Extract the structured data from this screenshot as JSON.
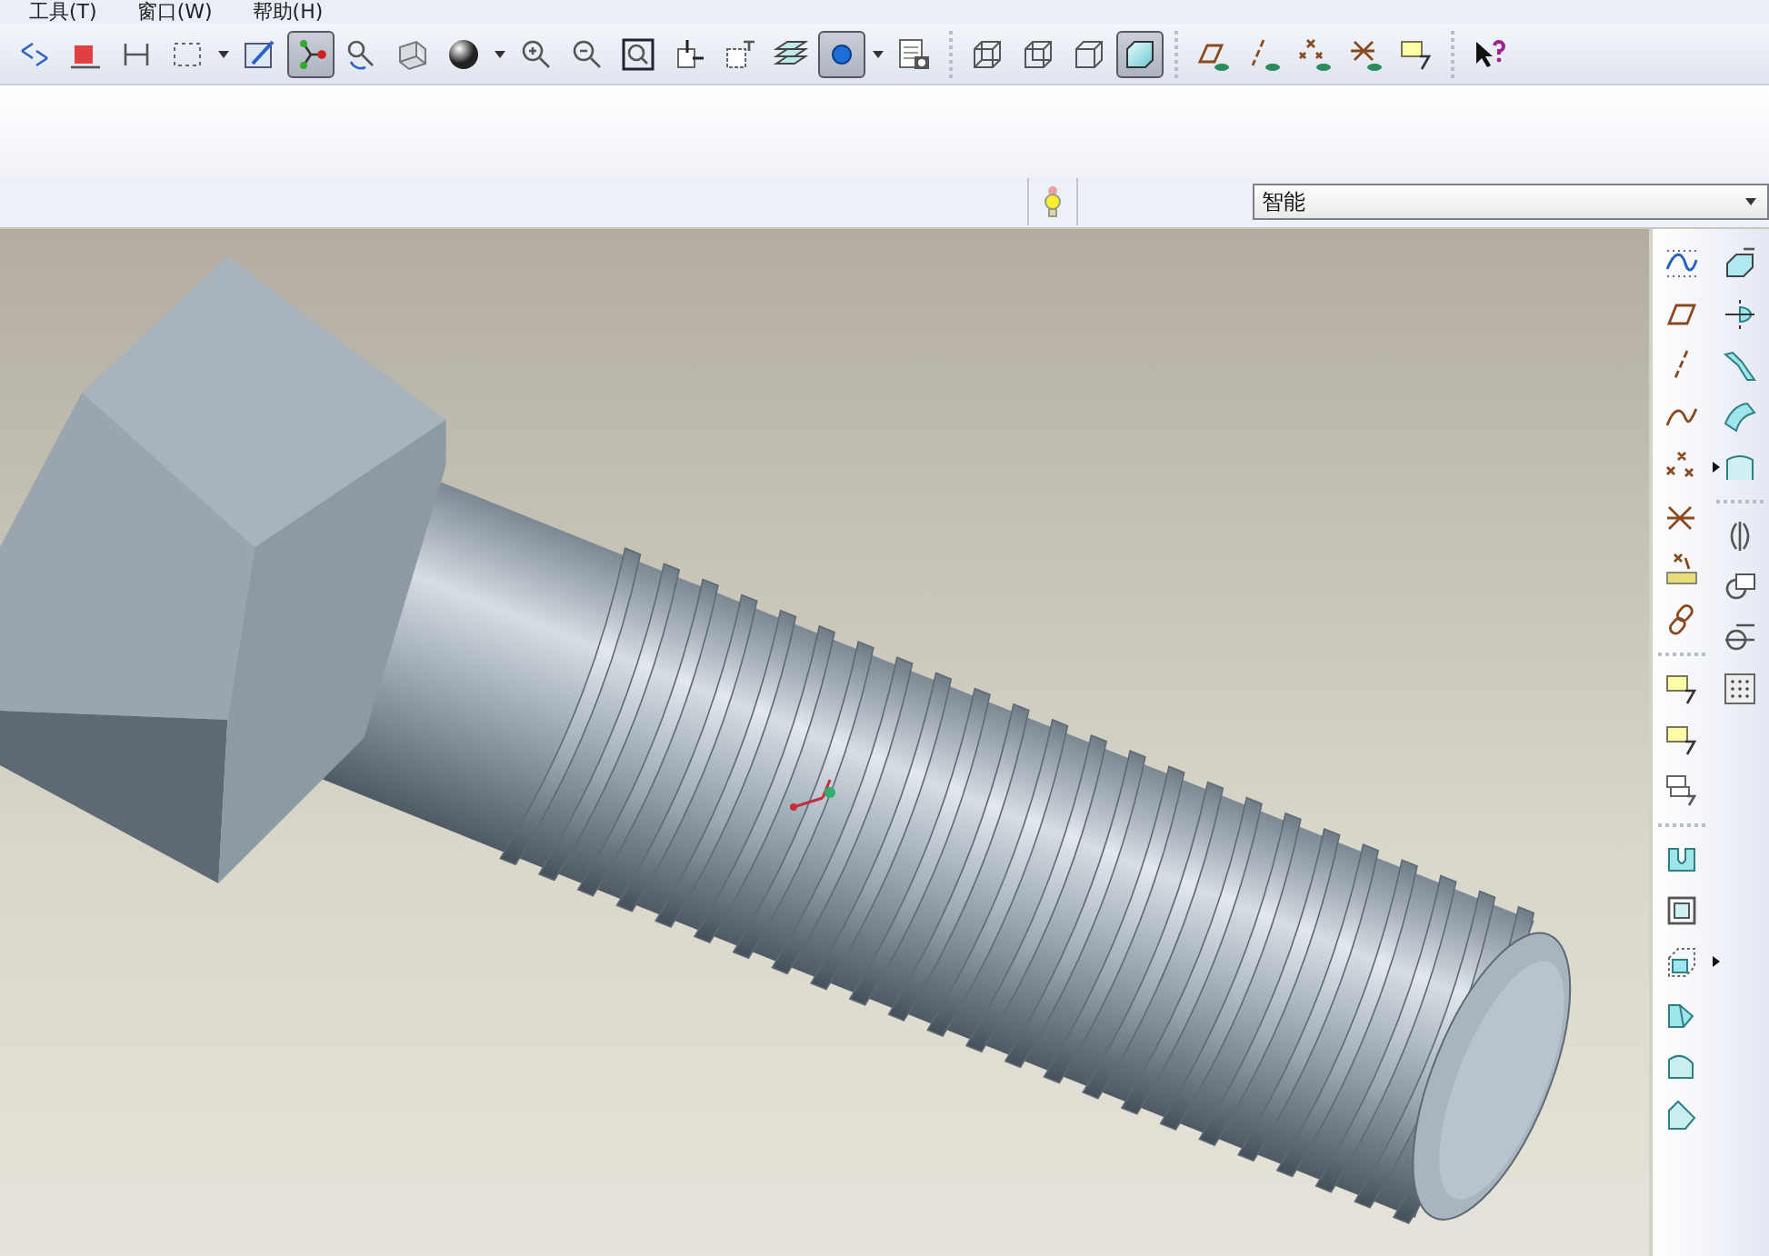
{
  "menu": [
    {
      "label": "工具(T)"
    },
    {
      "label": "窗口(W)"
    },
    {
      "label": "帮助(H)"
    }
  ],
  "toolbar": [
    {
      "kind": "regenerate",
      "selected": false
    },
    {
      "kind": "redbox",
      "selected": false
    },
    {
      "kind": "spin",
      "selected": false
    },
    {
      "kind": "selectbox",
      "selected": false,
      "dropdown": true
    },
    {
      "kind": "sketch",
      "selected": false
    },
    {
      "kind": "datum",
      "selected": true
    },
    {
      "kind": "spincenter",
      "selected": false
    },
    {
      "kind": "orient",
      "selected": false
    },
    {
      "kind": "sphere",
      "selected": false,
      "dropdown": true
    },
    {
      "kind": "zoomin",
      "selected": false
    },
    {
      "kind": "zoomout",
      "selected": false
    },
    {
      "kind": "refit",
      "selected": false
    },
    {
      "kind": "repaint",
      "selected": false
    },
    {
      "kind": "namedview",
      "selected": false
    },
    {
      "kind": "layers",
      "selected": false
    },
    {
      "kind": "bluesphere",
      "selected": true,
      "dropdown": true
    },
    {
      "kind": "viewmanager",
      "selected": false
    },
    {
      "kind": "separator"
    },
    {
      "kind": "wireframe",
      "selected": false
    },
    {
      "kind": "hidden",
      "selected": false
    },
    {
      "kind": "nohidden",
      "selected": false
    },
    {
      "kind": "shaded",
      "selected": true
    },
    {
      "kind": "separator"
    },
    {
      "kind": "planes",
      "selected": false
    },
    {
      "kind": "axes",
      "selected": false
    },
    {
      "kind": "points",
      "selected": false
    },
    {
      "kind": "csys",
      "selected": false
    },
    {
      "kind": "note",
      "selected": false
    },
    {
      "kind": "separator"
    },
    {
      "kind": "help",
      "selected": false
    }
  ],
  "filter": {
    "value": "智能"
  },
  "right_toolbar": {
    "column_1": [
      {
        "kind": "sketchcurve",
        "flyout": false
      },
      {
        "kind": "plane",
        "flyout": false
      },
      {
        "kind": "axis",
        "flyout": false
      },
      {
        "kind": "curve",
        "flyout": false
      },
      {
        "kind": "point",
        "flyout": true
      },
      {
        "kind": "csys",
        "flyout": false
      },
      {
        "kind": "analysis",
        "flyout": false
      },
      {
        "kind": "chain",
        "flyout": false
      },
      {
        "kind": "separator"
      },
      {
        "kind": "note",
        "flyout": false
      },
      {
        "kind": "note",
        "flyout": false
      },
      {
        "kind": "note2",
        "flyout": false
      },
      {
        "kind": "separator"
      },
      {
        "kind": "hole",
        "flyout": false
      },
      {
        "kind": "shell",
        "flyout": false
      },
      {
        "kind": "rib",
        "flyout": true
      },
      {
        "kind": "draft",
        "flyout": false
      },
      {
        "kind": "round",
        "flyout": false
      },
      {
        "kind": "chamfer",
        "flyout": false
      }
    ],
    "column_2": [
      {
        "kind": "extrude",
        "flyout": false
      },
      {
        "kind": "revolve",
        "flyout": false
      },
      {
        "kind": "sweep",
        "flyout": false
      },
      {
        "kind": "blend",
        "flyout": false
      },
      {
        "kind": "boundary",
        "flyout": false
      },
      {
        "kind": "separator"
      },
      {
        "kind": "mirror",
        "flyout": false
      },
      {
        "kind": "merge",
        "flyout": false
      },
      {
        "kind": "trim",
        "flyout": false
      },
      {
        "kind": "pattern",
        "flyout": false
      }
    ]
  }
}
